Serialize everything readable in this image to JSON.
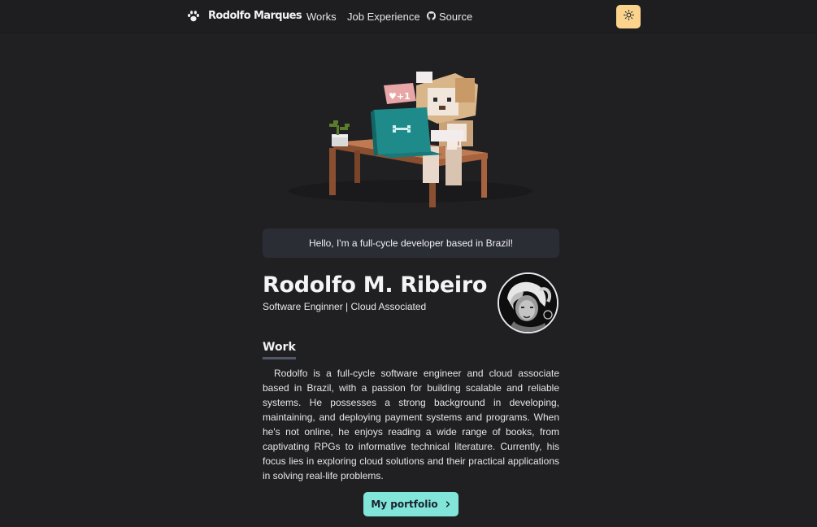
{
  "header": {
    "brand_icon": "paw-icon",
    "brand_name": "Rodolfo Marques",
    "nav": {
      "works": "Works",
      "experience": "Job Experience",
      "source": "Source",
      "source_icon": "github-icon"
    },
    "theme_toggle_icon": "sun-icon",
    "theme_toggle_color": "#fbd38d"
  },
  "hero": {
    "illustration": "voxel-dog-at-desk"
  },
  "intro": {
    "text": "Hello, I'm a full-cycle developer based in Brazil!"
  },
  "profile": {
    "name": "Rodolfo M. Ribeiro",
    "role": "Software Enginner | Cloud Associated",
    "avatar": "profile-photo"
  },
  "work": {
    "title": "Work",
    "body": "Rodolfo is a full-cycle software engineer and cloud associate based in Brazil, with a passion for building scalable and reliable systems. He possesses a strong background in developing, maintaining, and deploying payment systems and programs. When he's not online, he enjoys reading a wide range of books, from captivating RPGs to informative technical literature. Currently, his focus lies in exploring cloud solutions and their practical applications in solving real-life problems.",
    "button_label": "My portfolio",
    "button_icon": "chevron-right-icon",
    "button_color": "#81e6d9"
  },
  "colors": {
    "background": "#202023",
    "intro_background": "#2b2d35"
  }
}
